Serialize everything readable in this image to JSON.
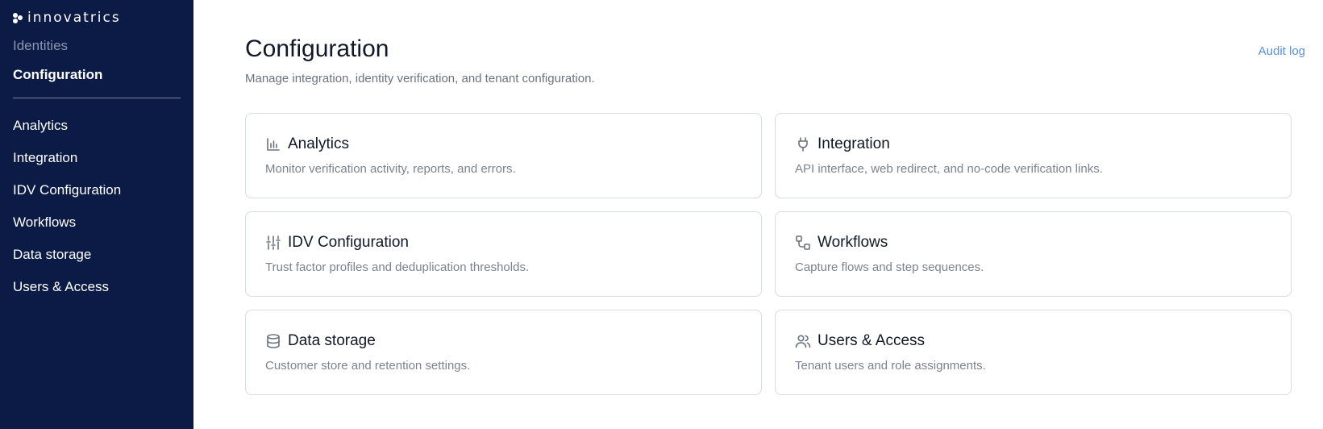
{
  "sidebar": {
    "logo_text": "innovatrics",
    "identities_label": "Identities",
    "configuration_label": "Configuration",
    "items": [
      {
        "label": "Analytics"
      },
      {
        "label": "Integration"
      },
      {
        "label": "IDV Configuration"
      },
      {
        "label": "Workflows"
      },
      {
        "label": "Data storage"
      },
      {
        "label": "Users & Access"
      }
    ]
  },
  "main": {
    "title": "Configuration",
    "subtitle": "Manage integration, identity verification, and tenant configuration.",
    "audit_link": "Audit log",
    "cards": [
      {
        "icon": "bar-chart-icon",
        "title": "Analytics",
        "description": "Monitor verification activity, reports, and errors."
      },
      {
        "icon": "plug-icon",
        "title": "Integration",
        "description": "API interface, web redirect, and no-code verification links."
      },
      {
        "icon": "sliders-icon",
        "title": "IDV Configuration",
        "description": "Trust factor profiles and deduplication thresholds."
      },
      {
        "icon": "workflow-icon",
        "title": "Workflows",
        "description": "Capture flows and step sequences."
      },
      {
        "icon": "database-icon",
        "title": "Data storage",
        "description": "Customer store and retention settings."
      },
      {
        "icon": "users-icon",
        "title": "Users & Access",
        "description": "Tenant users and role assignments."
      }
    ]
  },
  "colors": {
    "sidebar_bg": "#0b1b45",
    "link": "#5b8fd8",
    "card_border": "#d7dbe2"
  }
}
